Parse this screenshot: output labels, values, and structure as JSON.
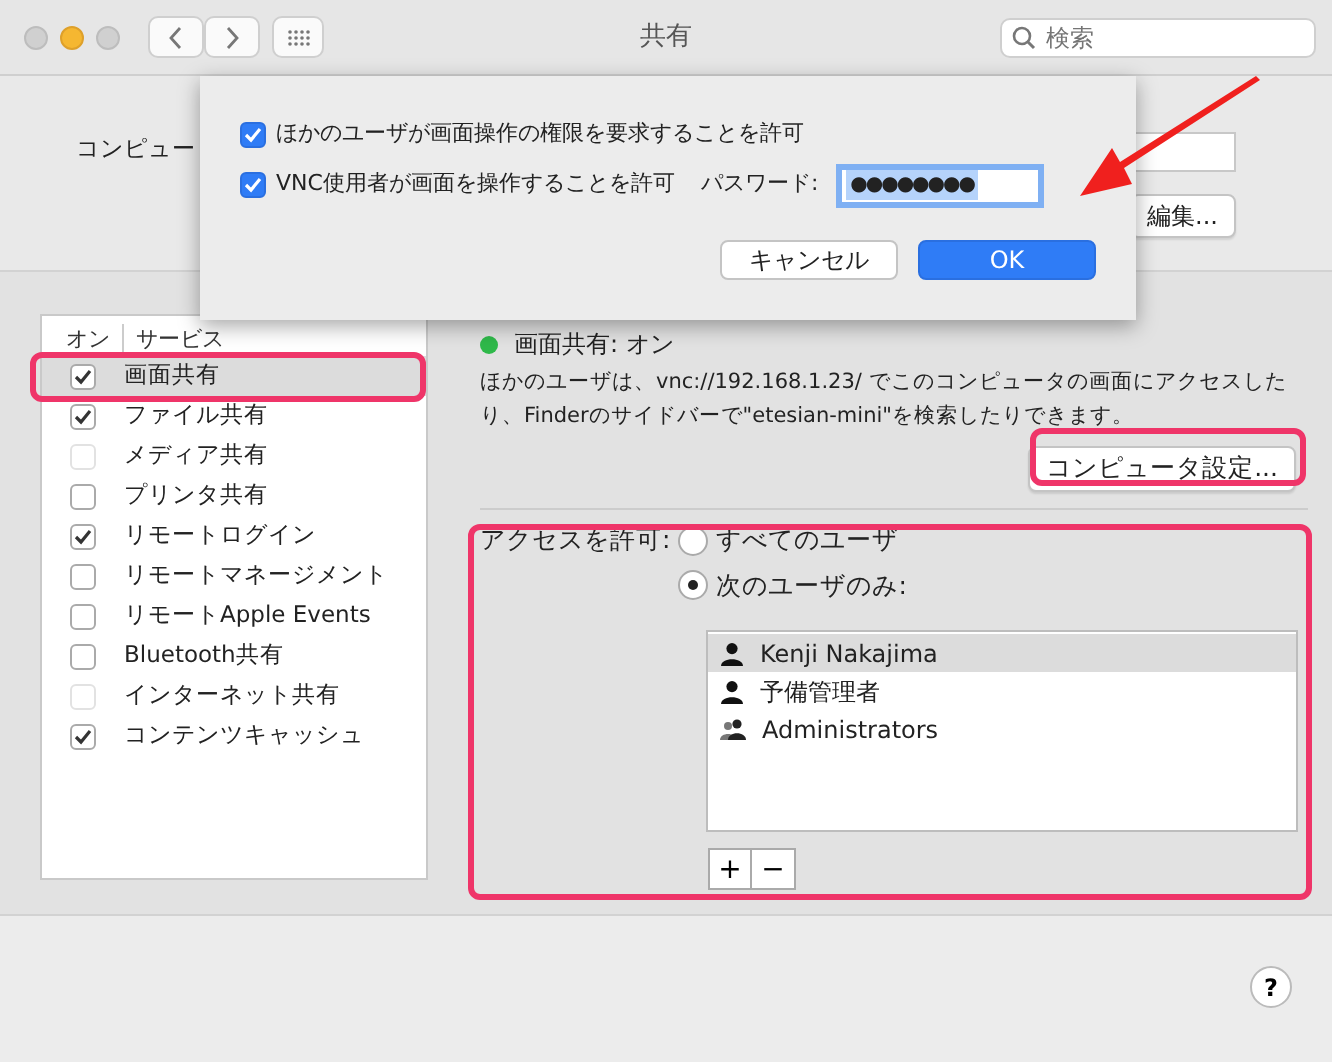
{
  "window": {
    "title": "共有",
    "search_placeholder": "検索"
  },
  "computer_name": {
    "label": "コンピュー",
    "edit_button": "編集..."
  },
  "sheet": {
    "options": [
      {
        "label": "ほかのユーザが画面操作の権限を要求することを許可",
        "checked": true
      },
      {
        "label": "VNC使用者が画面を操作することを許可",
        "checked": true
      }
    ],
    "password_label": "パスワード:",
    "password_value": "●●●●●●●●",
    "buttons": [
      {
        "label": "キャンセル",
        "kind": "default"
      },
      {
        "label": "OK",
        "kind": "primary"
      }
    ]
  },
  "services": {
    "columns": [
      "オン",
      "サービス"
    ],
    "items": [
      {
        "name": "画面共有",
        "checked": true,
        "disabled": false,
        "selected": true
      },
      {
        "name": "ファイル共有",
        "checked": true,
        "disabled": false,
        "selected": false
      },
      {
        "name": "メディア共有",
        "checked": false,
        "disabled": true,
        "selected": false
      },
      {
        "name": "プリンタ共有",
        "checked": false,
        "disabled": false,
        "selected": false
      },
      {
        "name": "リモートログイン",
        "checked": true,
        "disabled": false,
        "selected": false
      },
      {
        "name": "リモートマネージメント",
        "checked": false,
        "disabled": false,
        "selected": false
      },
      {
        "name": "リモートApple Events",
        "checked": false,
        "disabled": false,
        "selected": false
      },
      {
        "name": "Bluetooth共有",
        "checked": false,
        "disabled": false,
        "selected": false
      },
      {
        "name": "インターネット共有",
        "checked": false,
        "disabled": true,
        "selected": false
      },
      {
        "name": "コンテンツキャッシュ",
        "checked": true,
        "disabled": false,
        "selected": false
      }
    ]
  },
  "status": {
    "text": "画面共有: オン",
    "color": "#2fb94a"
  },
  "description": "ほかのユーザは、vnc://192.168.1.23/ でこのコンピュータの画面にアクセスしたり、Finderのサイドバーで\"etesian-mini\"を検索したりできます。",
  "computer_settings_button": "コンピュータ設定...",
  "access": {
    "label": "アクセスを許可:",
    "options": [
      {
        "label": "すべてのユーザ",
        "selected": false
      },
      {
        "label": "次のユーザのみ:",
        "selected": true
      }
    ],
    "users": [
      {
        "name": "Kenji Nakajima",
        "kind": "user",
        "selected": true
      },
      {
        "name": "予備管理者",
        "kind": "user",
        "selected": false
      },
      {
        "name": "Administrators",
        "kind": "group",
        "selected": false
      }
    ],
    "add_button": "+",
    "remove_button": "−"
  },
  "help_button": "?",
  "annotations": [
    {
      "kind": "frame"
    },
    {
      "kind": "frame"
    },
    {
      "kind": "frame"
    },
    {
      "kind": "arrow"
    }
  ]
}
